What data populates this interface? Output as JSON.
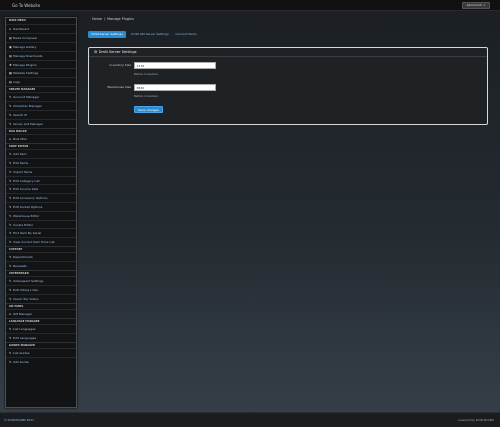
{
  "topbar": {
    "brand": "Go To Website",
    "user": "admin123"
  },
  "sidebar": {
    "sections": [
      {
        "title": "MAIN MENU",
        "items": [
          {
            "icon": "home-icon",
            "glyph": "⌂",
            "label": "Dashboard"
          },
          {
            "icon": "file-icon",
            "glyph": "▤",
            "label": "News Composer"
          },
          {
            "icon": "image-icon",
            "glyph": "▣",
            "label": "Manage Gallery"
          },
          {
            "icon": "file-icon",
            "glyph": "▤",
            "label": "Manage Downloads"
          },
          {
            "icon": "puzzle-icon",
            "glyph": "✚",
            "label": "Manage Plugins"
          },
          {
            "icon": "settings-icon",
            "glyph": "▦",
            "label": "Website Settings"
          },
          {
            "icon": "logs-icon",
            "glyph": "▤",
            "label": "Logs"
          }
        ]
      },
      {
        "title": "SERVER MANAGER",
        "items": [
          {
            "icon": "pencil-icon",
            "glyph": "✎",
            "label": "Account Manager"
          },
          {
            "icon": "pencil-icon",
            "glyph": "✎",
            "label": "Character Manager"
          },
          {
            "icon": "pencil-icon",
            "glyph": "✎",
            "label": "Search IP"
          },
          {
            "icon": "pencil-icon",
            "glyph": "✎",
            "label": "Server List Manager"
          }
        ]
      },
      {
        "title": "BUG MAILER",
        "items": [
          {
            "icon": "home-icon",
            "glyph": "⌂",
            "label": "Bulk Mail"
          }
        ]
      },
      {
        "title": "SHOP EDITOR",
        "items": [
          {
            "icon": "pencil-icon",
            "glyph": "✎",
            "label": "Add Item"
          },
          {
            "icon": "pencil-icon",
            "glyph": "✎",
            "label": "Edit Items"
          },
          {
            "icon": "pencil-icon",
            "glyph": "✎",
            "label": "Import Items"
          },
          {
            "icon": "pencil-icon",
            "glyph": "✎",
            "label": "Edit Category List"
          },
          {
            "icon": "pencil-icon",
            "glyph": "✎",
            "label": "Edit Income Sets"
          },
          {
            "icon": "pencil-icon",
            "glyph": "✎",
            "label": "Edit Accessory Options"
          },
          {
            "icon": "pencil-icon",
            "glyph": "✎",
            "label": "Edit Socket Options"
          },
          {
            "icon": "pencil-icon",
            "glyph": "✎",
            "label": "Warehouse Editor"
          },
          {
            "icon": "pencil-icon",
            "glyph": "✎",
            "label": "Cookie Editor"
          },
          {
            "icon": "pencil-icon",
            "glyph": "✎",
            "label": "Find Item By Serial"
          },
          {
            "icon": "pencil-icon",
            "glyph": "✎",
            "label": "View Current Item Price List"
          }
        ]
      },
      {
        "title": "SUPPORT",
        "items": [
          {
            "icon": "pencil-icon",
            "glyph": "✎",
            "label": "Departments"
          },
          {
            "icon": "pencil-icon",
            "glyph": "✎",
            "label": "Requests"
          }
        ]
      },
      {
        "title": "VOTEREWARD",
        "items": [
          {
            "icon": "pencil-icon",
            "glyph": "✎",
            "label": "Votereward Settings"
          },
          {
            "icon": "pencil-icon",
            "glyph": "✎",
            "label": "Edit Voting Links"
          },
          {
            "icon": "pencil-icon",
            "glyph": "✎",
            "label": "Check Top Voters"
          }
        ]
      },
      {
        "title": "GM PANEL",
        "items": [
          {
            "icon": "home-icon",
            "glyph": "⌂",
            "label": "GM Manager"
          }
        ]
      },
      {
        "title": "LANGUAGE MANAGER",
        "items": [
          {
            "icon": "pencil-icon",
            "glyph": "✎",
            "label": "List Languages"
          },
          {
            "icon": "pencil-icon",
            "glyph": "✎",
            "label": "Edit Languages"
          }
        ]
      },
      {
        "title": "GUIDES MANAGER",
        "items": [
          {
            "icon": "pencil-icon",
            "glyph": "✎",
            "label": "List Guides"
          },
          {
            "icon": "pencil-icon",
            "glyph": "✎",
            "label": "Add Guide"
          }
        ]
      }
    ]
  },
  "breadcrumb": {
    "home": "Home",
    "current": "Manage Plugins"
  },
  "tabs": [
    {
      "label": "DmN Server Settings",
      "active": true
    },
    {
      "label": "DmN GM Server Settings",
      "active": false
    },
    {
      "label": "Convert Items",
      "active": false
    }
  ],
  "panel": {
    "title": "DmN Server Settings",
    "fields": [
      {
        "label": "Inventory Size",
        "value": "1376",
        "help": "Before conversion"
      },
      {
        "label": "Warehouse Size",
        "value": "3840",
        "help": "Before conversion"
      }
    ],
    "save_label": "Save changes"
  },
  "footer": {
    "left": "© DmN MuCMS 2017",
    "right": "powered by DmN MuCMS"
  },
  "colors": {
    "accent": "#2b8bd1",
    "link": "#9dc3e8"
  }
}
